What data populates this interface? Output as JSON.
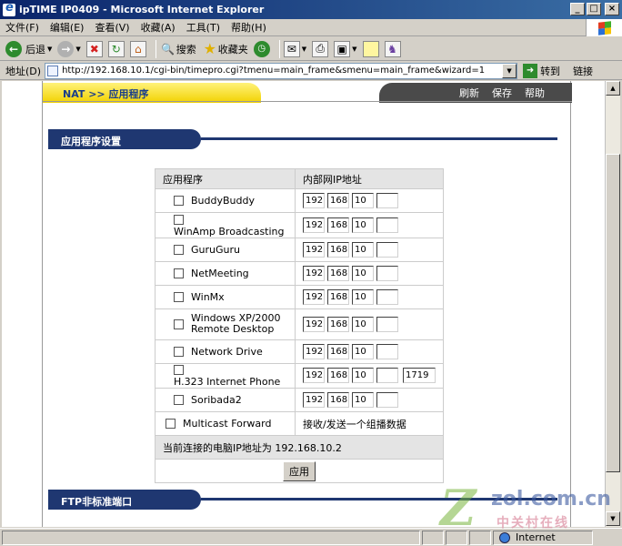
{
  "window": {
    "title": "ipTIME IP0409 - Microsoft Internet Explorer",
    "min": "_",
    "max": "□",
    "close": "×"
  },
  "menu": [
    "文件(F)",
    "编辑(E)",
    "查看(V)",
    "收藏(A)",
    "工具(T)",
    "帮助(H)"
  ],
  "toolbar": {
    "back": "后退",
    "search": "搜索",
    "favorites": "收藏夹"
  },
  "address": {
    "label": "地址(D)",
    "url": "http://192.168.10.1/cgi-bin/timepro.cgi?tmenu=main_frame&smenu=main_frame&wizard=1",
    "go": "转到",
    "links": "链接"
  },
  "page": {
    "breadcrumb": "NAT >> 应用程序",
    "nav": [
      "刷新",
      "保存",
      "帮助"
    ],
    "section1": "应用程序设置",
    "section2": "FTP非标准端口",
    "table": {
      "col_app": "应用程序",
      "col_ip": "内部网IP地址",
      "rows": [
        {
          "name": "BuddyBuddy",
          "ip": [
            "192",
            "168",
            "10",
            ""
          ]
        },
        {
          "name": "WinAmp Broadcasting",
          "ip": [
            "192",
            "168",
            "10",
            ""
          ]
        },
        {
          "name": "GuruGuru",
          "ip": [
            "192",
            "168",
            "10",
            ""
          ]
        },
        {
          "name": "NetMeeting",
          "ip": [
            "192",
            "168",
            "10",
            ""
          ]
        },
        {
          "name": "WinMx",
          "ip": [
            "192",
            "168",
            "10",
            ""
          ]
        },
        {
          "name": "Windows XP/2000 Remote Desktop",
          "ip": [
            "192",
            "168",
            "10",
            ""
          ]
        },
        {
          "name": "Network Drive",
          "ip": [
            "192",
            "168",
            "10",
            ""
          ]
        },
        {
          "name": "H.323 Internet Phone",
          "ip": [
            "192",
            "168",
            "10",
            ""
          ],
          "port": "1719"
        },
        {
          "name": "Soribada2",
          "ip": [
            "192",
            "168",
            "10",
            ""
          ]
        }
      ],
      "multicast_label": "Multicast Forward",
      "multicast_desc": "接收/发送一个组播数据",
      "current_ip_text": "当前连接的电脑IP地址为  192.168.10.2",
      "apply": "应用"
    }
  },
  "status": {
    "zone": "Internet"
  },
  "watermark": {
    "brand": "zol.com.cn",
    "sub": "中关村在线"
  }
}
